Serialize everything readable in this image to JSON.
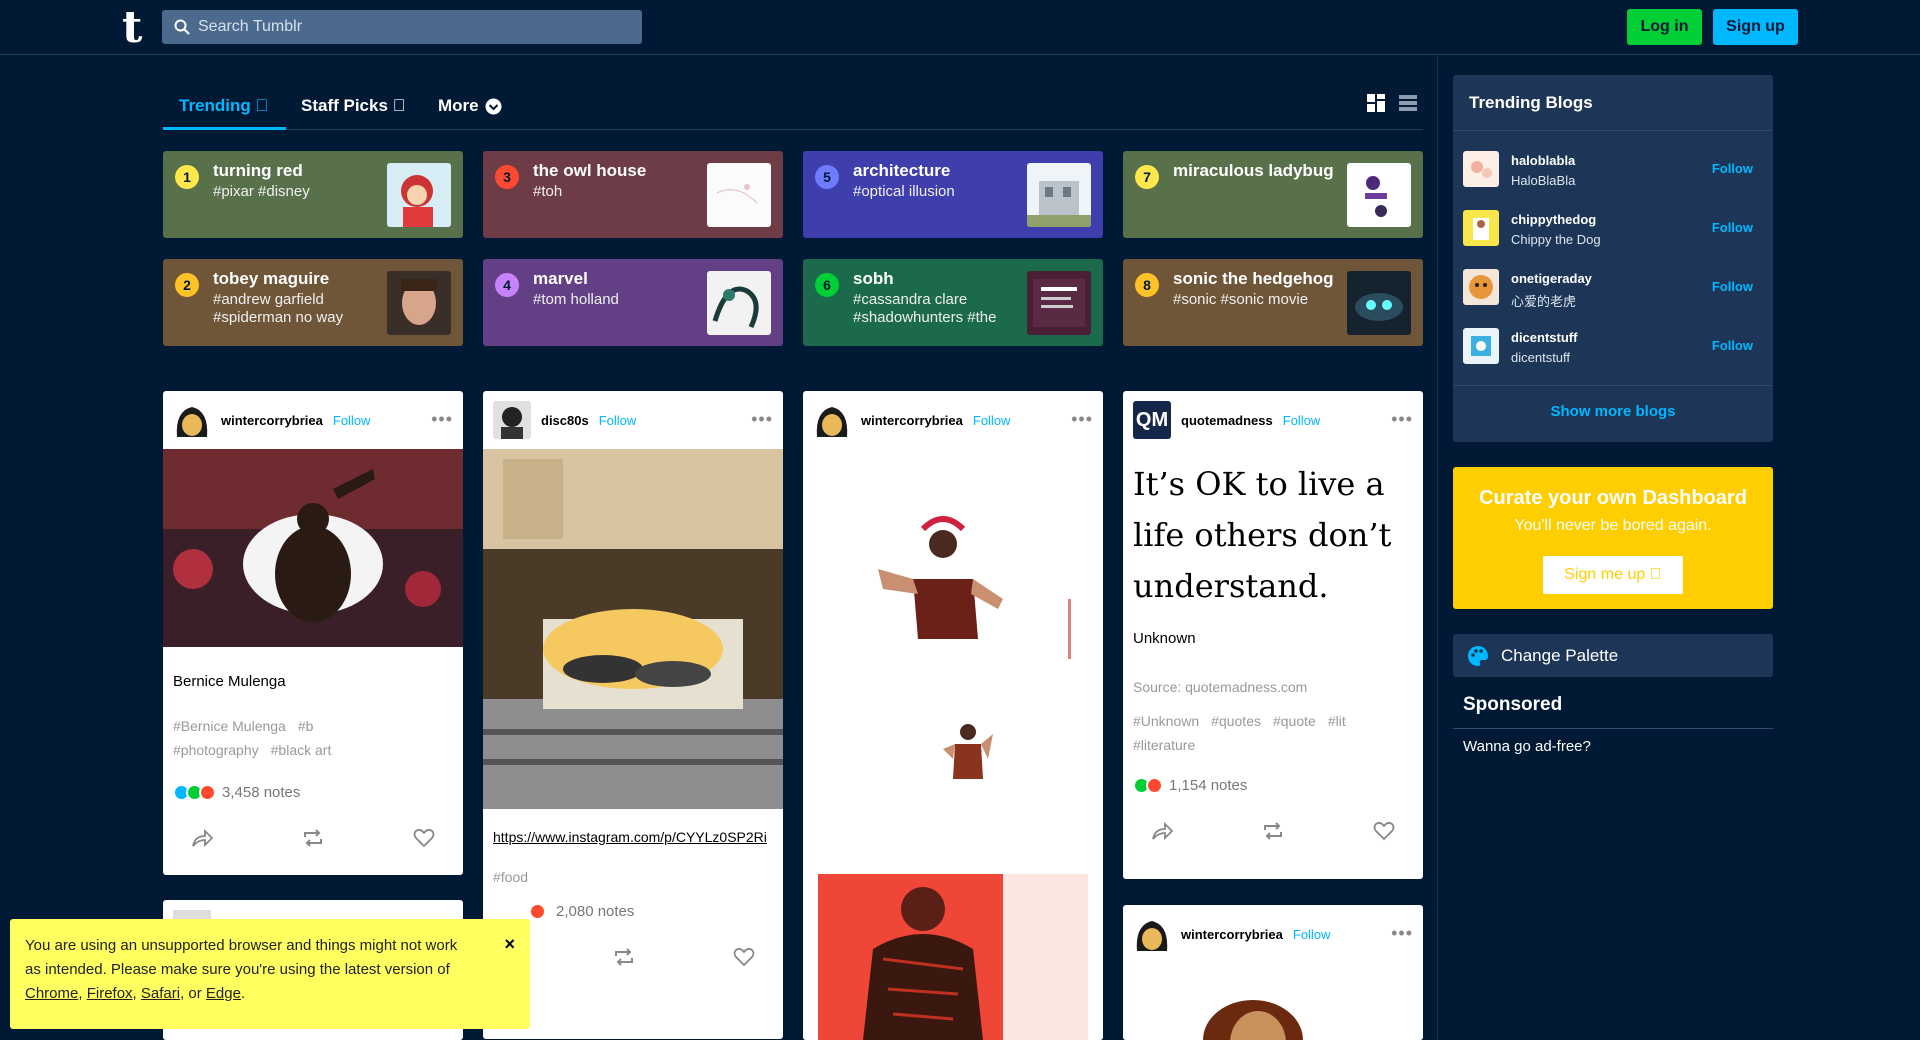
{
  "header": {
    "logo": "t",
    "search_placeholder": "Search Tumblr",
    "login_label": "Log in",
    "signup_label": "Sign up"
  },
  "tabs": [
    {
      "label": "Trending ⃞"
    },
    {
      "label": "Staff Picks ⃞"
    },
    {
      "label": "More"
    }
  ],
  "trending": [
    {
      "rank": "1",
      "title": "turning red",
      "tags": "#pixar #disney",
      "color": "#58714b",
      "rank_color": "#ffe74c"
    },
    {
      "rank": "2",
      "title": "tobey maguire",
      "tags": "#andrew garfield #spiderman no way",
      "color": "#6f5638",
      "rank_color": "#ffc328"
    },
    {
      "rank": "3",
      "title": "the owl house",
      "tags": "#toh",
      "color": "#6e3c47",
      "rank_color": "#ff4930"
    },
    {
      "rank": "4",
      "title": "marvel",
      "tags": "#tom holland",
      "color": "#633f85",
      "rank_color": "#c782ff"
    },
    {
      "rank": "5",
      "title": "architecture",
      "tags": "#optical illusion",
      "color": "#3e3eac",
      "rank_color": "#6e7cff"
    },
    {
      "rank": "6",
      "title": "sobh",
      "tags": "#cassandra clare #shadowhunters #the",
      "color": "#1b6a4b",
      "rank_color": "#00cf35"
    },
    {
      "rank": "7",
      "title": "miraculous ladybug",
      "tags": "",
      "color": "#58714b",
      "rank_color": "#ffe74c"
    },
    {
      "rank": "8",
      "title": "sonic the hedgehog",
      "tags": "#sonic #sonic movie",
      "color": "#6f5638",
      "rank_color": "#ffc328"
    }
  ],
  "posts": {
    "p1": {
      "user": "wintercorrybriea",
      "follow": "Follow",
      "text": "Bernice Mulenga",
      "tags": [
        "#Bernice Mulenga",
        "#b",
        "#photography",
        "#black art"
      ],
      "notes": "3,458 notes"
    },
    "p2": {
      "user": "disc80s",
      "follow": "Follow",
      "link": "https://www.instagram.com/p/CYYLz0SP2Ri",
      "tags": [
        "#food"
      ],
      "notes": "2,080 notes"
    },
    "p3": {
      "user": "wintercorrybriea",
      "follow": "Follow"
    },
    "p4": {
      "user": "quotemadness",
      "follow": "Follow",
      "quote": "It’s OK to live a life others don’t understand.",
      "author": "Unknown",
      "source": "Source: quotemadness.com",
      "tags": [
        "#Unknown",
        "#quotes",
        "#quote",
        "#lit",
        "#literature"
      ],
      "notes": "1,154 notes",
      "avatar_text": "QM"
    },
    "p5": {
      "user": "wintercorrybriea",
      "follow": "Follow"
    }
  },
  "sidebar": {
    "trending_title": "Trending Blogs",
    "blogs": [
      {
        "name": "haloblabla",
        "title": "HaloBlaBla",
        "follow": "Follow"
      },
      {
        "name": "chippythedog",
        "title": "Chippy the Dog",
        "follow": "Follow"
      },
      {
        "name": "onetigeraday",
        "title": "心爱的老虎",
        "follow": "Follow"
      },
      {
        "name": "dicentstuff",
        "title": "dicentstuff",
        "follow": "Follow"
      }
    ],
    "show_more": "Show more blogs",
    "curate_title": "Curate your own Dashboard",
    "curate_sub": "You'll never be bored again.",
    "curate_btn": "Sign me up ⃞",
    "palette": "Change Palette",
    "sponsored": "Sponsored",
    "adfree": "Wanna go ad-free?"
  },
  "warning": {
    "text1": "You are using an unsupported browser and things might not work as intended. Please make sure you're using the latest version of ",
    "chrome": "Chrome",
    "firefox": "Firefox",
    "safari": "Safari",
    "edge": "Edge",
    "or": ", or ",
    "comma": ", ",
    "end": ".",
    "close": "×"
  }
}
